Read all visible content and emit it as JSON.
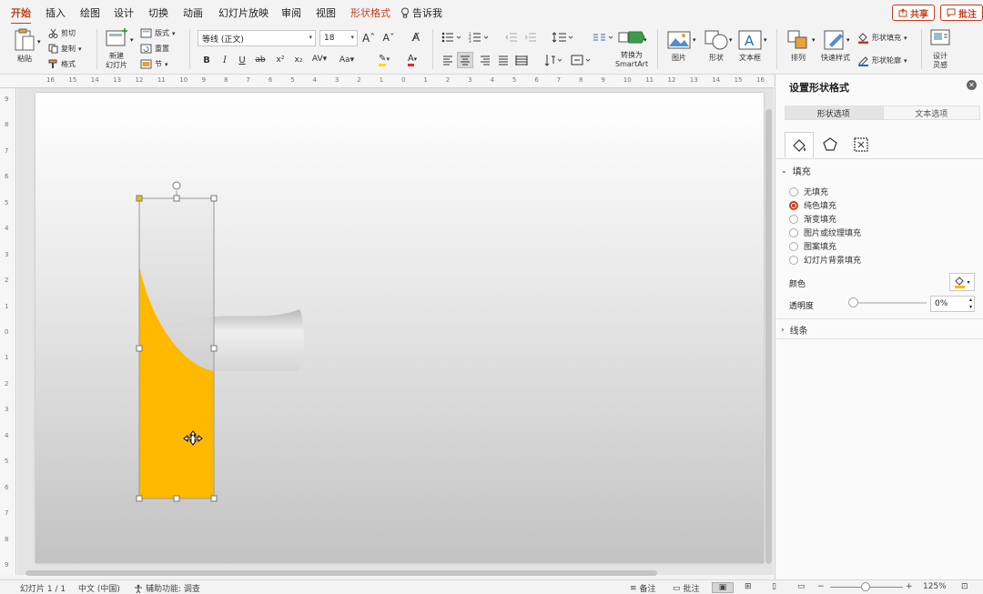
{
  "menu": {
    "tabs": [
      "开始",
      "插入",
      "绘图",
      "设计",
      "切换",
      "动画",
      "幻灯片放映",
      "审阅",
      "视图"
    ],
    "active_tab": "开始",
    "contextual_tab": "形状格式",
    "tell_me": "告诉我",
    "share": "共享",
    "comments": "批注"
  },
  "ribbon": {
    "paste": "粘贴",
    "cut": "剪切",
    "copy": "复制",
    "format_painter": "格式",
    "new_slide": "新建\n幻灯片",
    "layout": "版式",
    "reset": "重置",
    "section": "节",
    "font_name": "等线 (正文)",
    "font_size": "18",
    "convert_smartart": "转换为\nSmartArt",
    "picture": "图片",
    "shapes": "形状",
    "textbox": "文本框",
    "arrange": "排列",
    "quick_styles": "快速样式",
    "shape_fill": "形状填充",
    "shape_outline": "形状轮廓",
    "designer": "设计\n灵感"
  },
  "ruler": {
    "top_ticks": [
      "16",
      "15",
      "14",
      "13",
      "12",
      "11",
      "10",
      "9",
      "8",
      "7",
      "6",
      "5",
      "4",
      "3",
      "2",
      "1",
      "0",
      "1",
      "2",
      "3",
      "4",
      "5",
      "6",
      "7",
      "8",
      "9",
      "10",
      "11",
      "12",
      "13",
      "14",
      "15",
      "16"
    ],
    "left_ticks": [
      "9",
      "8",
      "7",
      "6",
      "5",
      "4",
      "3",
      "2",
      "1",
      "0",
      "1",
      "2",
      "3",
      "4",
      "5",
      "6",
      "7",
      "8",
      "9"
    ]
  },
  "pane": {
    "title": "设置形状格式",
    "tabs": [
      "形状选项",
      "文本选项"
    ],
    "active_tab": "形状选项",
    "fill_section": "填充",
    "fill_options": [
      "无填充",
      "纯色填充",
      "渐变填充",
      "图片或纹理填充",
      "图案填充",
      "幻灯片背景填充"
    ],
    "selected_fill": "纯色填充",
    "color_label": "颜色",
    "transparency_label": "透明度",
    "transparency_value": "0%",
    "line_section": "线条"
  },
  "colors": {
    "accent": "#c43e1c",
    "shape_fill": "#ffb900"
  },
  "statusbar": {
    "slide_info": "幻灯片 1 / 1",
    "language": "中文 (中国)",
    "accessibility": "辅助功能: 调查",
    "notes": "备注",
    "comments": "批注",
    "zoom": "125%"
  }
}
